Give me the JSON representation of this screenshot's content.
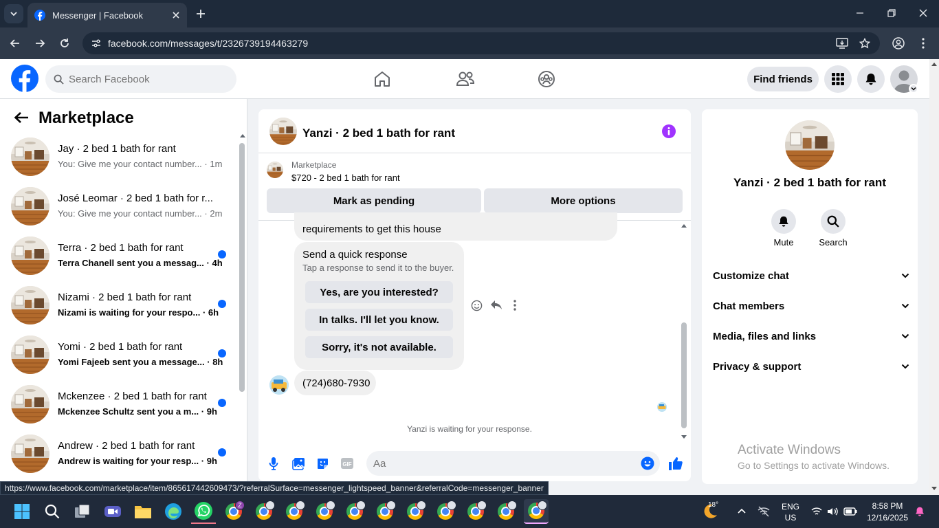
{
  "browser": {
    "tab_title": "Messenger | Facebook",
    "url": "facebook.com/messages/t/2326739194463279",
    "status_url": "https://www.facebook.com/marketplace/item/865617442609473/?referralSurface=messenger_lightspeed_banner&referralCode=messenger_banner"
  },
  "header": {
    "search_placeholder": "Search Facebook",
    "find_friends": "Find friends"
  },
  "sidebar": {
    "title": "Marketplace",
    "conversations": [
      {
        "name": "Jay · 2 bed 1 bath for rant",
        "preview": "You: Give me your contact number...",
        "time": "· 1m",
        "unread": false
      },
      {
        "name": "José Leomar · 2 bed 1 bath for r...",
        "preview": "You: Give me your contact number...",
        "time": "· 2m",
        "unread": false
      },
      {
        "name": "Terra · 2 bed 1 bath for rant",
        "preview": "Terra Chanell sent you a messag...",
        "time": "· 4h",
        "unread": true
      },
      {
        "name": "Nizami · 2 bed 1 bath for rant",
        "preview": "Nizami is waiting for your respo...",
        "time": "· 6h",
        "unread": true
      },
      {
        "name": "Yomi · 2 bed 1 bath for rant",
        "preview": "Yomi Fajeeb sent you a message...",
        "time": "· 8h",
        "unread": true
      },
      {
        "name": "Mckenzee · 2 bed 1 bath for rant",
        "preview": "Mckenzee Schultz sent you a m...",
        "time": "· 9h",
        "unread": true
      },
      {
        "name": "Andrew · 2 bed 1 bath for rant",
        "preview": "Andrew is waiting for your resp...",
        "time": "· 9h",
        "unread": true
      }
    ]
  },
  "chat": {
    "title": "Yanzi · 2 bed 1 bath for rant",
    "banner_label": "Marketplace",
    "banner_listing": "$720 - 2 bed 1 bath for rant",
    "mark_pending": "Mark as pending",
    "more_options": "More options",
    "partial_message": "requirements to get this house",
    "quick_title": "Send a quick response",
    "quick_subtitle": "Tap a response to send it to the buyer.",
    "quick_replies": [
      "Yes, are you interested?",
      "In talks. I'll let you know.",
      "Sorry, it's not available."
    ],
    "phone_message": "(724)680-7930",
    "waiting_note": "Yanzi is waiting for your response.",
    "composer_placeholder": "Aa"
  },
  "details": {
    "name": "Yanzi · 2 bed 1 bath for rant",
    "mute": "Mute",
    "search": "Search",
    "sections": [
      "Customize chat",
      "Chat members",
      "Media, files and links",
      "Privacy & support"
    ]
  },
  "watermark": {
    "title": "Activate Windows",
    "subtitle": "Go to Settings to activate Windows."
  },
  "taskbar": {
    "weather_temp": "18°",
    "lang_top": "ENG",
    "lang_bottom": "US",
    "time": "8:58 PM",
    "date": "12/16/2025",
    "profile_badge": "Z"
  },
  "colors": {
    "fb_blue": "#0866ff",
    "info_purple": "#a033ff",
    "unread_dot": "#0866ff"
  }
}
